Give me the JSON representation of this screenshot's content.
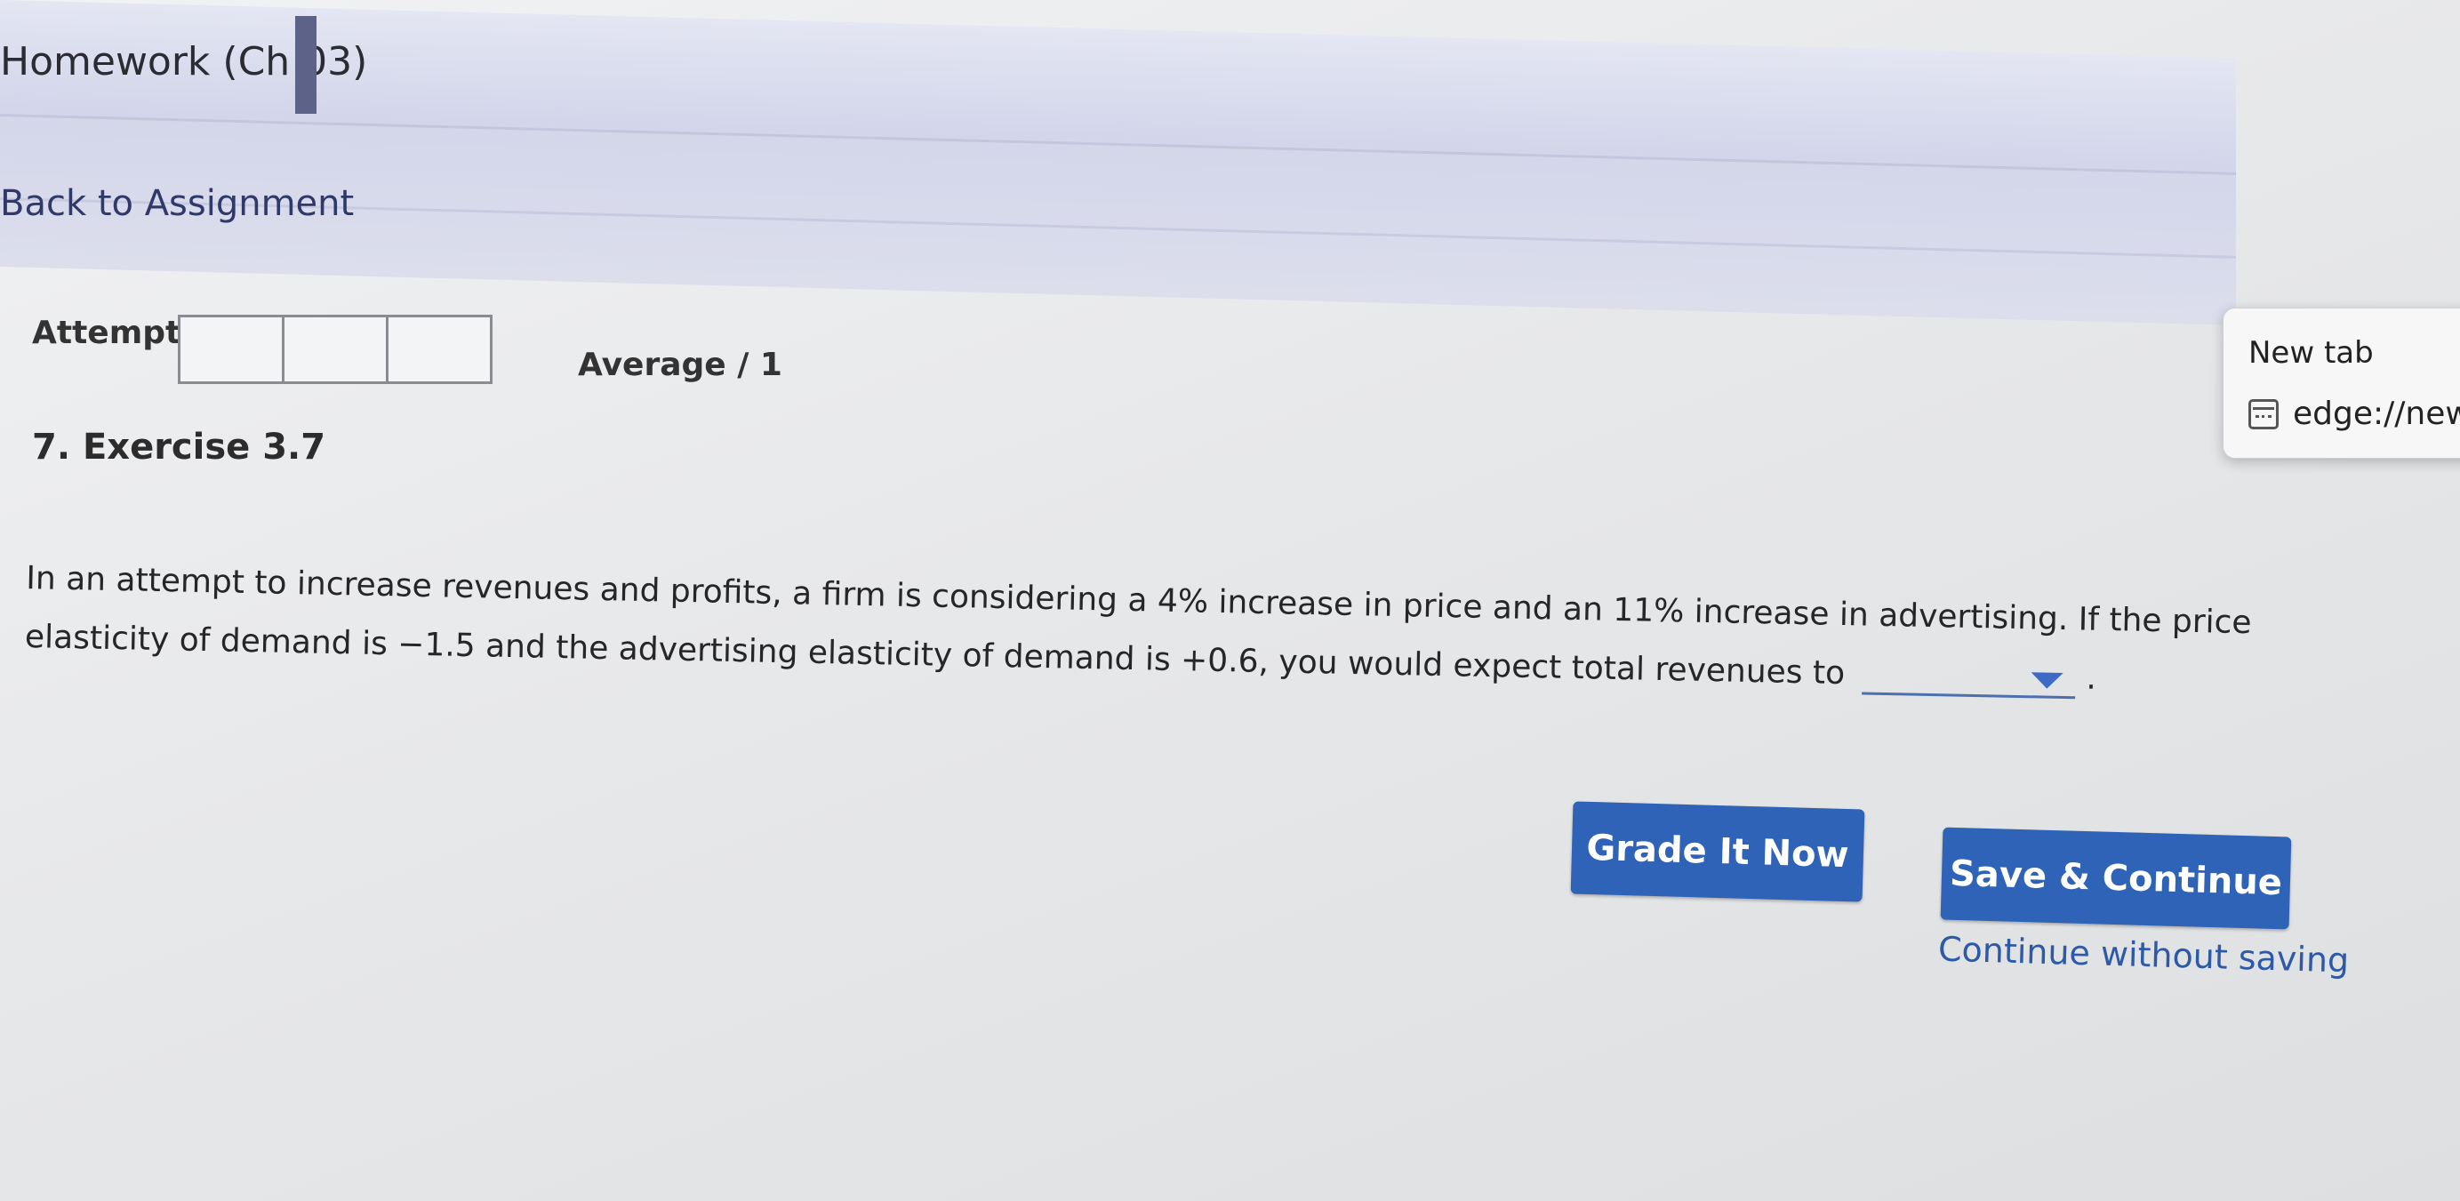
{
  "header": {
    "title": "Homework (Ch 03)",
    "back_link": "Back to Assignment"
  },
  "attempts": {
    "label": "Attempts",
    "boxes": [
      "",
      "",
      ""
    ],
    "average": "Average / 1"
  },
  "exercise": {
    "title": "7. Exercise 3.7",
    "question": "In an attempt to increase revenues and profits, a firm is considering a 4% increase in price and an 11% increase in advertising. If the price elasticity of demand is −1.5 and the advertising elasticity of demand is +0.6, you would expect total revenues to",
    "dropdown_value": "",
    "dropdown_icon": "caret-down-icon",
    "period": "."
  },
  "actions": {
    "grade_label": "Grade It Now",
    "save_label": "Save & Continue",
    "continue_label": "Continue without saving"
  },
  "tab_preview": {
    "title": "New tab",
    "url": "edge://new",
    "icon": "page-icon"
  },
  "colors": {
    "button": "#2f63b7",
    "link": "#2d5aa8",
    "dropdown_arrow": "#3c6ac4"
  }
}
